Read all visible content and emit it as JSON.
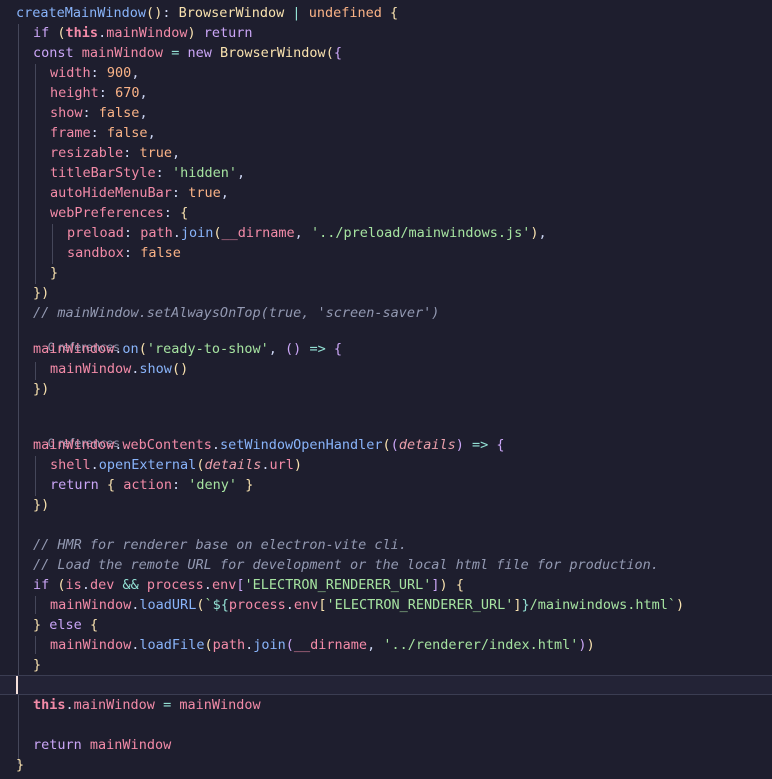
{
  "editor": {
    "code_lines": [
      "createMainWindow(): BrowserWindow | undefined {",
      "  if (this.mainWindow) return",
      "  const mainWindow = new BrowserWindow({",
      "    width: 900,",
      "    height: 670,",
      "    show: false,",
      "    frame: false,",
      "    resizable: true,",
      "    titleBarStyle: 'hidden',",
      "    autoHideMenuBar: true,",
      "    webPreferences: {",
      "      preload: path.join(__dirname, '../preload/mainwindows.js'),",
      "      sandbox: false",
      "    }",
      "  })",
      "  // mainWindow.setAlwaysOnTop(true, 'screen-saver')",
      "  mainWindow.on('ready-to-show', () => {",
      "    mainWindow.show()",
      "  })",
      "",
      "  mainWindow.webContents.setWindowOpenHandler((details) => {",
      "    shell.openExternal(details.url)",
      "    return { action: 'deny' }",
      "  })",
      "",
      "  // HMR for renderer base on electron-vite cli.",
      "  // Load the remote URL for development or the local html file for production.",
      "  if (is.dev && process.env['ELECTRON_RENDERER_URL']) {",
      "    mainWindow.loadURL(`${process.env['ELECTRON_RENDERER_URL']}/mainwindows.html`)",
      "  } else {",
      "    mainWindow.loadFile(path.join(__dirname, '../renderer/index.html'))",
      "  }",
      "",
      "  this.mainWindow = mainWindow",
      "",
      "  return mainWindow",
      "}"
    ],
    "codelens": [
      "0 references",
      "0 references"
    ]
  }
}
